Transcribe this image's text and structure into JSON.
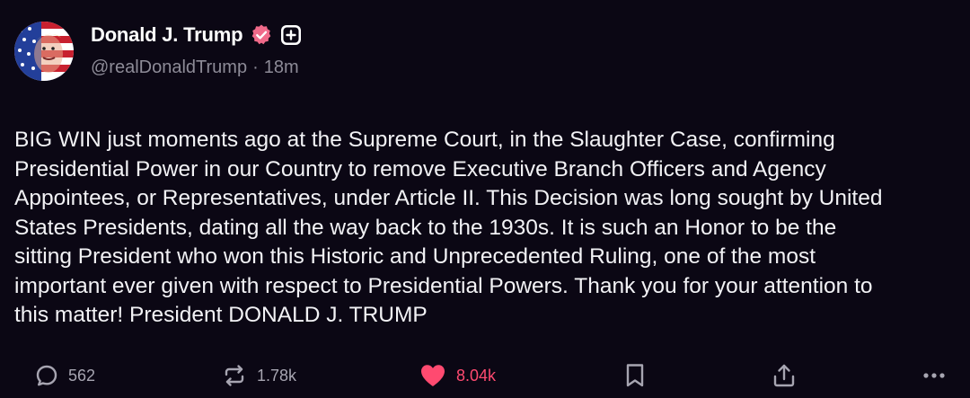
{
  "post": {
    "author": {
      "display_name": "Donald J. Trump",
      "handle": "@realDonaldTrump",
      "separator": "·",
      "timestamp": "18m"
    },
    "body": "BIG WIN just moments ago at the Supreme Court, in the Slaughter Case, confirming\nPresidential Power in our Country to remove Executive Branch Officers and Agency\nAppointees, or Representatives, under Article II. This Decision was long sought by United\nStates Presidents, dating all the way back to the 1930s. It is such an Honor to be the\nsitting President who won this Historic and Unprecedented Ruling, one of the most\nimportant ever given with respect to Presidential Powers. Thank you for your attention to\nthis matter! President DONALD J. TRUMP",
    "actions": {
      "replies": "562",
      "reposts": "1.78k",
      "likes": "8.04k"
    }
  },
  "icons": {
    "reply": "reply-bubble-icon",
    "repost": "repost-arrows-icon",
    "like": "heart-icon",
    "bookmark": "bookmark-icon",
    "share": "share-upload-icon",
    "more": "more-dots-icon",
    "verified": "verified-badge-icon",
    "plus": "plus-badge-icon"
  },
  "colors": {
    "background": "#0b0714",
    "text": "#ffffff",
    "muted": "#8d8b97",
    "like": "#ff4a70",
    "verified": "#f06a8a"
  }
}
